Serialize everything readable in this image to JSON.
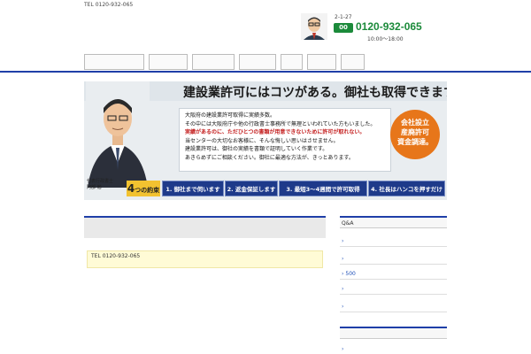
{
  "header": {
    "top_line": "TEL 0120-932-065",
    "title": "",
    "subtitle": "",
    "address": "2-1-27",
    "freedial_badge": "00",
    "phone": "0120-932-065",
    "hours": "10:00〜18:00"
  },
  "nav": {
    "items": [
      {
        "label": "",
        "width": 68
      },
      {
        "label": "",
        "width": 44
      },
      {
        "label": "",
        "width": 48
      },
      {
        "label": "",
        "width": 42
      },
      {
        "label": "",
        "width": 25
      },
      {
        "label": "",
        "width": 33
      },
      {
        "label": "",
        "width": 27
      }
    ]
  },
  "banner": {
    "headline": "建設業許可にはコツがある。御社も取得できます。",
    "body": [
      "大阪府の建設業許可取得に実績多数。",
      "その中には大阪府庁や他の行政書士事務所で無理といわれていた方もいました。",
      "実績があるのに、ただひとつの書類が用意できないために許可が取れない。",
      "当センターの大切なお客様に、そんな悔しい思いはさせません。",
      "建設業許可は、御社の実績を書類で証明していく作業です。",
      "あきらめずにご相談ください。御社に最適な方法が、きっとあります。"
    ],
    "badge": "会社設立\n産廃許可\n資金調達。",
    "name_caption": "代表行政書士\n阿部 勉",
    "promise_title": "つの約束",
    "promise_number": "4",
    "promises": [
      "1. 御社まで伺います",
      "2. 返金保証します",
      "3. 最短3〜4週間で許可取得",
      "4. 社長はハンコを押すだけ"
    ]
  },
  "main": {
    "section_title": "",
    "tel_line": "TEL 0120-932-065",
    "tel_red": "",
    "tel_rest": "",
    "heading": "",
    "lines": [
      "",
      "",
      "",
      "",
      ""
    ],
    "orange_text": ""
  },
  "sidebar": {
    "section1_title": "Q&A",
    "section1_items": [
      "",
      "",
      "500",
      "",
      ""
    ],
    "section2_title": "",
    "section2_items": [
      ""
    ]
  }
}
